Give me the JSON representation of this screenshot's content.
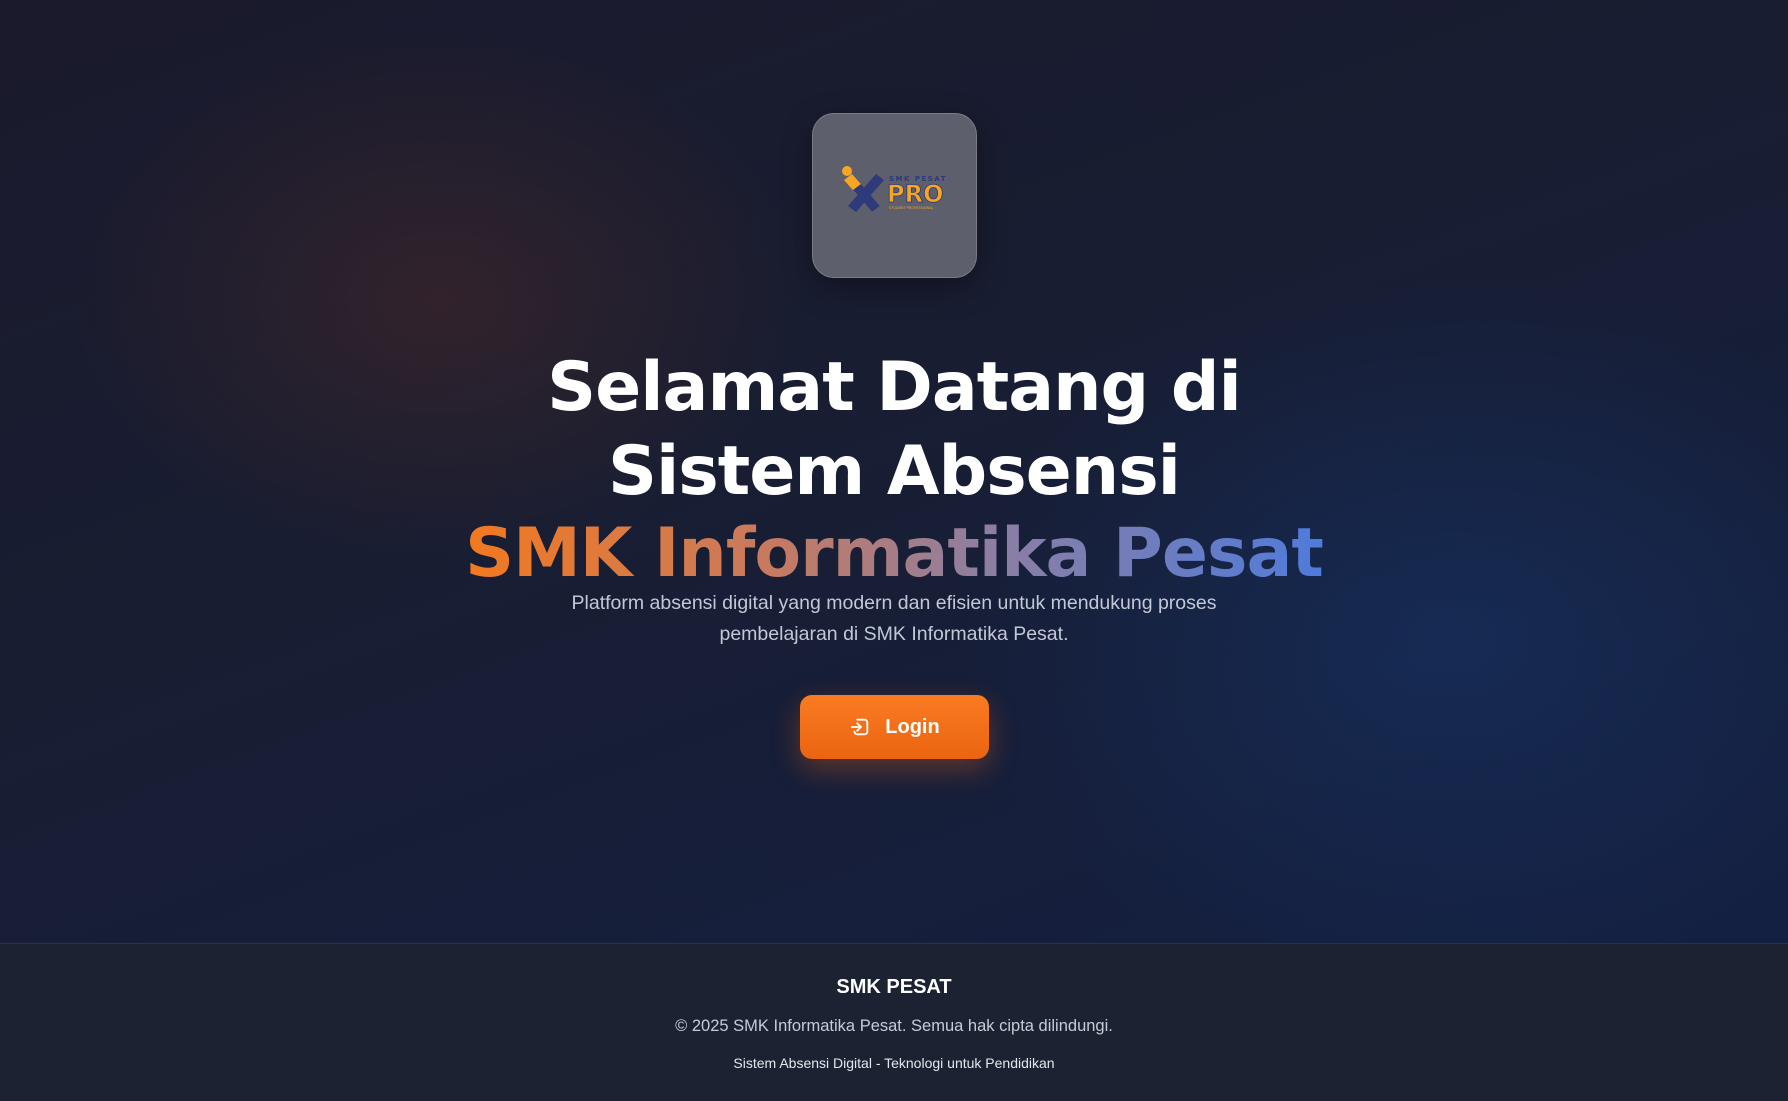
{
  "logo": {
    "icon": "smk-pesat-xpro-logo",
    "text_top": "SMK PESAT",
    "text_main": "PRO",
    "text_tagline": "STUDENT PROFESSIONAL"
  },
  "hero": {
    "title_line1": "Selamat Datang di",
    "title_line2": "Sistem Absensi",
    "title_line3": "SMK Informatika Pesat",
    "subtitle": "Platform absensi digital yang modern dan efisien untuk mendukung proses pembelajaran di SMK Informatika Pesat."
  },
  "login_button": {
    "label": "Login",
    "icon": "login-icon"
  },
  "footer": {
    "brand": "SMK PESAT",
    "copyright": "© 2025 SMK Informatika Pesat. Semua hak cipta dilindungi.",
    "tagline": "Sistem Absensi Digital - Teknologi untuk Pendidikan"
  },
  "colors": {
    "accent_orange": "#f97316",
    "accent_blue": "#4f7bdb",
    "background": "#141a2c",
    "footer_bg": "#1b2333"
  }
}
